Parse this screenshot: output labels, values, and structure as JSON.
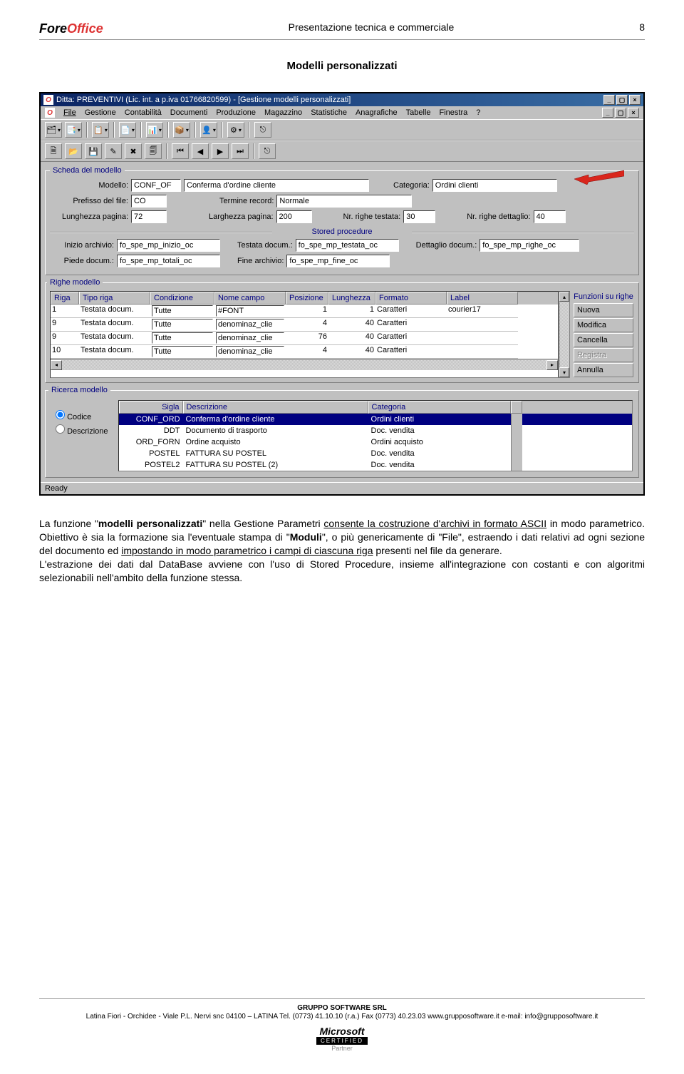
{
  "header": {
    "logo_prefix": "Fore",
    "logo_suffix": "Office",
    "doc_title": "Presentazione tecnica e commerciale",
    "page_num": "8"
  },
  "section_title": "Modelli personalizzati",
  "window": {
    "title": "Ditta: PREVENTIVI (Lic. int. a p.iva 01766820599) - [Gestione modelli personalizzati]",
    "menu": [
      "File",
      "Gestione",
      "Contabilità",
      "Documenti",
      "Produzione",
      "Magazzino",
      "Statistiche",
      "Anagrafiche",
      "Tabelle",
      "Finestra",
      "?"
    ],
    "scheda_legend": "Scheda del modello",
    "labels": {
      "modello": "Modello:",
      "categoria": "Categoria:",
      "prefisso": "Prefisso del file:",
      "termine": "Termine record:",
      "lung_pagina": "Lunghezza pagina:",
      "larg_pagina": "Larghezza pagina:",
      "righe_testata": "Nr. righe testata:",
      "righe_dettaglio": "Nr. righe dettaglio:",
      "stored_title": "Stored procedure",
      "inizio_archivio": "Inizio archivio:",
      "testata_docum": "Testata docum.:",
      "dettaglio_docum": "Dettaglio docum.:",
      "piede_docum": "Piede docum.:",
      "fine_archivio": "Fine archivio:"
    },
    "values": {
      "modello_code": "CONF_OF",
      "modello_desc": "Conferma d'ordine cliente",
      "categoria": "Ordini clienti",
      "prefisso": "CO",
      "termine": "Normale",
      "lung_pagina": "72",
      "larg_pagina": "200",
      "righe_testata": "30",
      "righe_dettaglio": "40",
      "inizio_archivio": "fo_spe_mp_inizio_oc",
      "testata_docum": "fo_spe_mp_testata_oc",
      "dettaglio_docum": "fo_spe_mp_righe_oc",
      "piede_docum": "fo_spe_mp_totali_oc",
      "fine_archivio": "fo_spe_mp_fine_oc"
    },
    "righe_legend": "Righe modello",
    "grid_headers": [
      "Riga",
      "Tipo riga",
      "Condizione",
      "Nome campo",
      "Posizione",
      "Lunghezza",
      "Formato",
      "Label"
    ],
    "grid_rows": [
      {
        "riga": "1",
        "tipo": "Testata docum.",
        "cond": "Tutte",
        "campo": "#FONT",
        "pos": "1",
        "lun": "1",
        "fmt": "Caratteri",
        "label": "courier17"
      },
      {
        "riga": "9",
        "tipo": "Testata docum.",
        "cond": "Tutte",
        "campo": "denominaz_clie",
        "pos": "4",
        "lun": "40",
        "fmt": "Caratteri",
        "label": ""
      },
      {
        "riga": "9",
        "tipo": "Testata docum.",
        "cond": "Tutte",
        "campo": "denominaz_clie",
        "pos": "76",
        "lun": "40",
        "fmt": "Caratteri",
        "label": ""
      },
      {
        "riga": "10",
        "tipo": "Testata docum.",
        "cond": "Tutte",
        "campo": "denominaz_clie",
        "pos": "4",
        "lun": "40",
        "fmt": "Caratteri",
        "label": ""
      }
    ],
    "side_funcs_title": "Funzioni su righe",
    "side_funcs": [
      "Nuova",
      "Modifica",
      "Cancella",
      "Registra",
      "Annulla"
    ],
    "ricerca_legend": "Ricerca modello",
    "radio_codice": "Codice",
    "radio_descrizione": "Descrizione",
    "search_headers": [
      "Sigla",
      "Descrizione",
      "Categoria"
    ],
    "search_rows": [
      {
        "sigla": "CONF_ORD",
        "desc": "Conferma d'ordine cliente",
        "cat": "Ordini clienti",
        "sel": true
      },
      {
        "sigla": "DDT",
        "desc": "Documento di trasporto",
        "cat": "Doc. vendita",
        "sel": false
      },
      {
        "sigla": "ORD_FORN",
        "desc": "Ordine acquisto",
        "cat": "Ordini acquisto",
        "sel": false
      },
      {
        "sigla": "POSTEL",
        "desc": "FATTURA SU POSTEL",
        "cat": "Doc. vendita",
        "sel": false
      },
      {
        "sigla": "POSTEL2",
        "desc": "FATTURA SU POSTEL (2)",
        "cat": "Doc. vendita",
        "sel": false
      }
    ],
    "status": "Ready"
  },
  "body": {
    "p1a": "La funzione \"",
    "p1b": "modelli personalizzati",
    "p1c": "\" nella Gestione Parametri ",
    "p1d": "consente la costruzione d'archivi in formato ASCII",
    "p1e": " in modo parametrico. Obiettivo è sia la formazione sia l'eventuale stampa di \"",
    "p1f": "Moduli",
    "p1g": "\", o più genericamente di \"File\", estraendo i dati relativi ad ogni sezione del documento ed ",
    "p1h": "impostando in modo parametrico i campi di ciascuna riga",
    "p1i": " presenti nel file da generare.",
    "p2": "L'estrazione dei dati dal DataBase avviene con l'uso di Stored Procedure, insieme all'integrazione con costanti e con algoritmi selezionabili nell'ambito della funzione stessa."
  },
  "footer": {
    "company": "GRUPPO SOFTWARE SRL",
    "line2": "Latina Fiori - Orchidee - Viale P.L. Nervi snc      04100 – LATINA   Tel. (0773) 41.10.10 (r.a.)   Fax (0773) 40.23.03   www.grupposoftware.it   e-mail: info@grupposoftware.it",
    "ms": "Microsoft",
    "cert": "CERTIFIED",
    "partner": "Partner"
  }
}
